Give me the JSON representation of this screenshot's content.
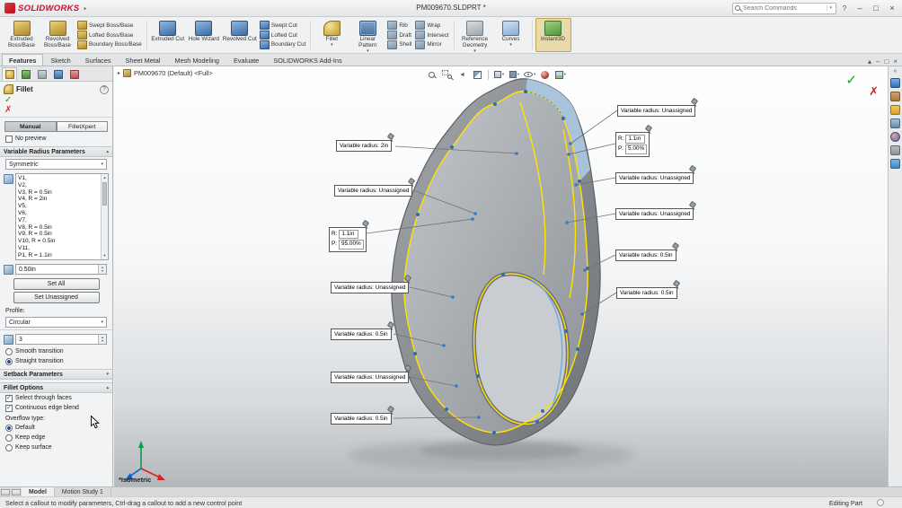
{
  "glyphs": {
    "caret_down": "▾",
    "caret_up": "▴",
    "arrow_right": "▸",
    "back": "◄",
    "minimize": "–",
    "restore": "□",
    "close": "×",
    "collapse": "«",
    "spin_up": "▴",
    "spin_down": "▾",
    "help": "?"
  },
  "titlebar": {
    "logo": "SOLIDWORKS",
    "doc_title": "PM009670.SLDPRT *",
    "search": {
      "placeholder": "Search Commands"
    }
  },
  "commandmanager": {
    "tabs": [
      "Features",
      "Sketch",
      "Surfaces",
      "Sheet Metal",
      "Mesh Modeling",
      "Evaluate",
      "SOLIDWORKS Add-Ins"
    ],
    "buttons": {
      "extruded_boss": "Extruded Boss/Base",
      "revolved_boss": "Revolved Boss/Base",
      "swept_boss": "Swept Boss/Base",
      "lofted_boss": "Lofted Boss/Base",
      "boundary_boss": "Boundary Boss/Base",
      "extruded_cut": "Extruded Cut",
      "hole_wizard": "Hole Wizard",
      "revolved_cut": "Revolved Cut",
      "swept_cut": "Swept Cut",
      "lofted_cut": "Lofted Cut",
      "boundary_cut": "Boundary Cut",
      "fillet": "Fillet",
      "linear_pattern": "Linear Pattern",
      "rib": "Rib",
      "draft": "Draft",
      "shell": "Shell",
      "wrap": "Wrap",
      "intersect": "Intersect",
      "mirror": "Mirror",
      "reference_geometry": "Reference Geometry",
      "curves": "Curves",
      "instant3d": "Instant3D"
    }
  },
  "panel": {
    "title": "Fillet",
    "ok_icon": "✓",
    "cancel_icon": "✗",
    "mode_manual": "Manual",
    "mode_expert": "FilletXpert",
    "no_preview": "No preview",
    "sections": {
      "variable_radius": "Variable Radius Parameters",
      "setback": "Setback Parameters",
      "fillet_options": "Fillet Options"
    },
    "symmetric": "Symmetric",
    "radius_list": [
      "V1,",
      "V2,",
      "V3, R = 0.5in",
      "V4, R = 2in",
      "V5,",
      "V6,",
      "V7,",
      "V8, R = 0.5in",
      "V9, R = 0.5in",
      "V10, R = 0.5in",
      "V11,",
      "P1, R = 1.1in"
    ],
    "radius_value": "0.50in",
    "set_all": "Set All",
    "set_unassigned": "Set Unassigned",
    "profile_label": "Profile:",
    "profile_value": "Circular",
    "instances": "3",
    "smooth_transition": "Smooth transition",
    "straight_transition": "Straight transition",
    "select_through_faces": "Select through faces",
    "continuous_edge_blend": "Continuous edge blend",
    "overflow_label": "Overflow type:",
    "overflow_default": "Default",
    "overflow_keep_edge": "Keep edge",
    "overflow_keep_surface": "Keep surface"
  },
  "viewport": {
    "tree_node": "PM009670 (Default) <Full>",
    "orientation_label": "*Isometric",
    "callouts": {
      "vr_2in": "Variable radius: 2in",
      "vr_unassigned": "Variable radius: Unassigned",
      "vr_half": "Variable radius: 0.5in",
      "r_label": "R:",
      "p_label": "P:",
      "rp_top": {
        "r": "1.1in",
        "p": "5.00%"
      },
      "rp_left": {
        "r": "1.1in",
        "p": "95.00%"
      }
    }
  },
  "taskpane": {
    "icons": [
      "solidworks-resources",
      "design-library",
      "file-explorer",
      "view-palette",
      "appearances-scenes",
      "custom-properties",
      "solidworks-forum"
    ]
  },
  "bottombar": {
    "tabs": [
      "Model",
      "Motion Study 1"
    ],
    "status_message": "Select a callout to modify parameters, Ctrl-drag a callout to add a new control point",
    "editing_status": "Editing Part"
  }
}
